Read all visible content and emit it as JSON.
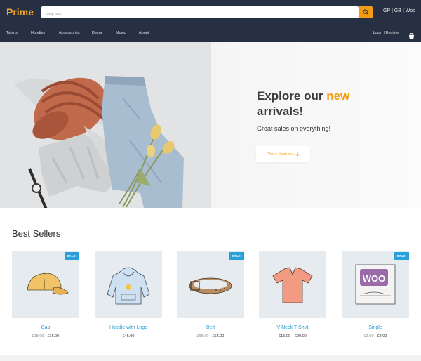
{
  "header": {
    "logo": "Prime",
    "search_placeholder": "Shop now...",
    "currencies": [
      "GP",
      "GB",
      "Woo"
    ],
    "currency_sep": "|"
  },
  "nav": {
    "items": [
      "Tshirts",
      "Hoodies",
      "Accessories",
      "Decor",
      "Music",
      "About"
    ],
    "account": "Login | Register"
  },
  "hero": {
    "title_prefix": "Explore our ",
    "title_accent": "new",
    "title_suffix": "arrivals!",
    "subtitle": "Great sales on everything!",
    "button": "Check them out"
  },
  "best_sellers": {
    "title": "Best Sellers",
    "sale_label": "SALE!",
    "products": [
      {
        "name": "Cap",
        "old_price": "£18.00",
        "price": "£16.00",
        "sale": true,
        "icon": "cap-icon"
      },
      {
        "name": "Hoodie with Logo",
        "old_price": "",
        "price": "£45.00",
        "sale": false,
        "icon": "hoodie-icon"
      },
      {
        "name": "Belt",
        "old_price": "£65.00",
        "price": "£55.00",
        "sale": true,
        "icon": "belt-icon"
      },
      {
        "name": "V-Neck T-Shirt",
        "old_price": "",
        "price": "£15.00 – £20.00",
        "sale": false,
        "icon": "tshirt-icon"
      },
      {
        "name": "Single",
        "old_price": "£3.00",
        "price": "£2.00",
        "sale": true,
        "icon": "woo-single-icon"
      }
    ]
  },
  "colors": {
    "header_bg": "#263042",
    "accent": "#f39c12",
    "link": "#2a9fd6",
    "sale_badge": "#2aa0d9"
  }
}
